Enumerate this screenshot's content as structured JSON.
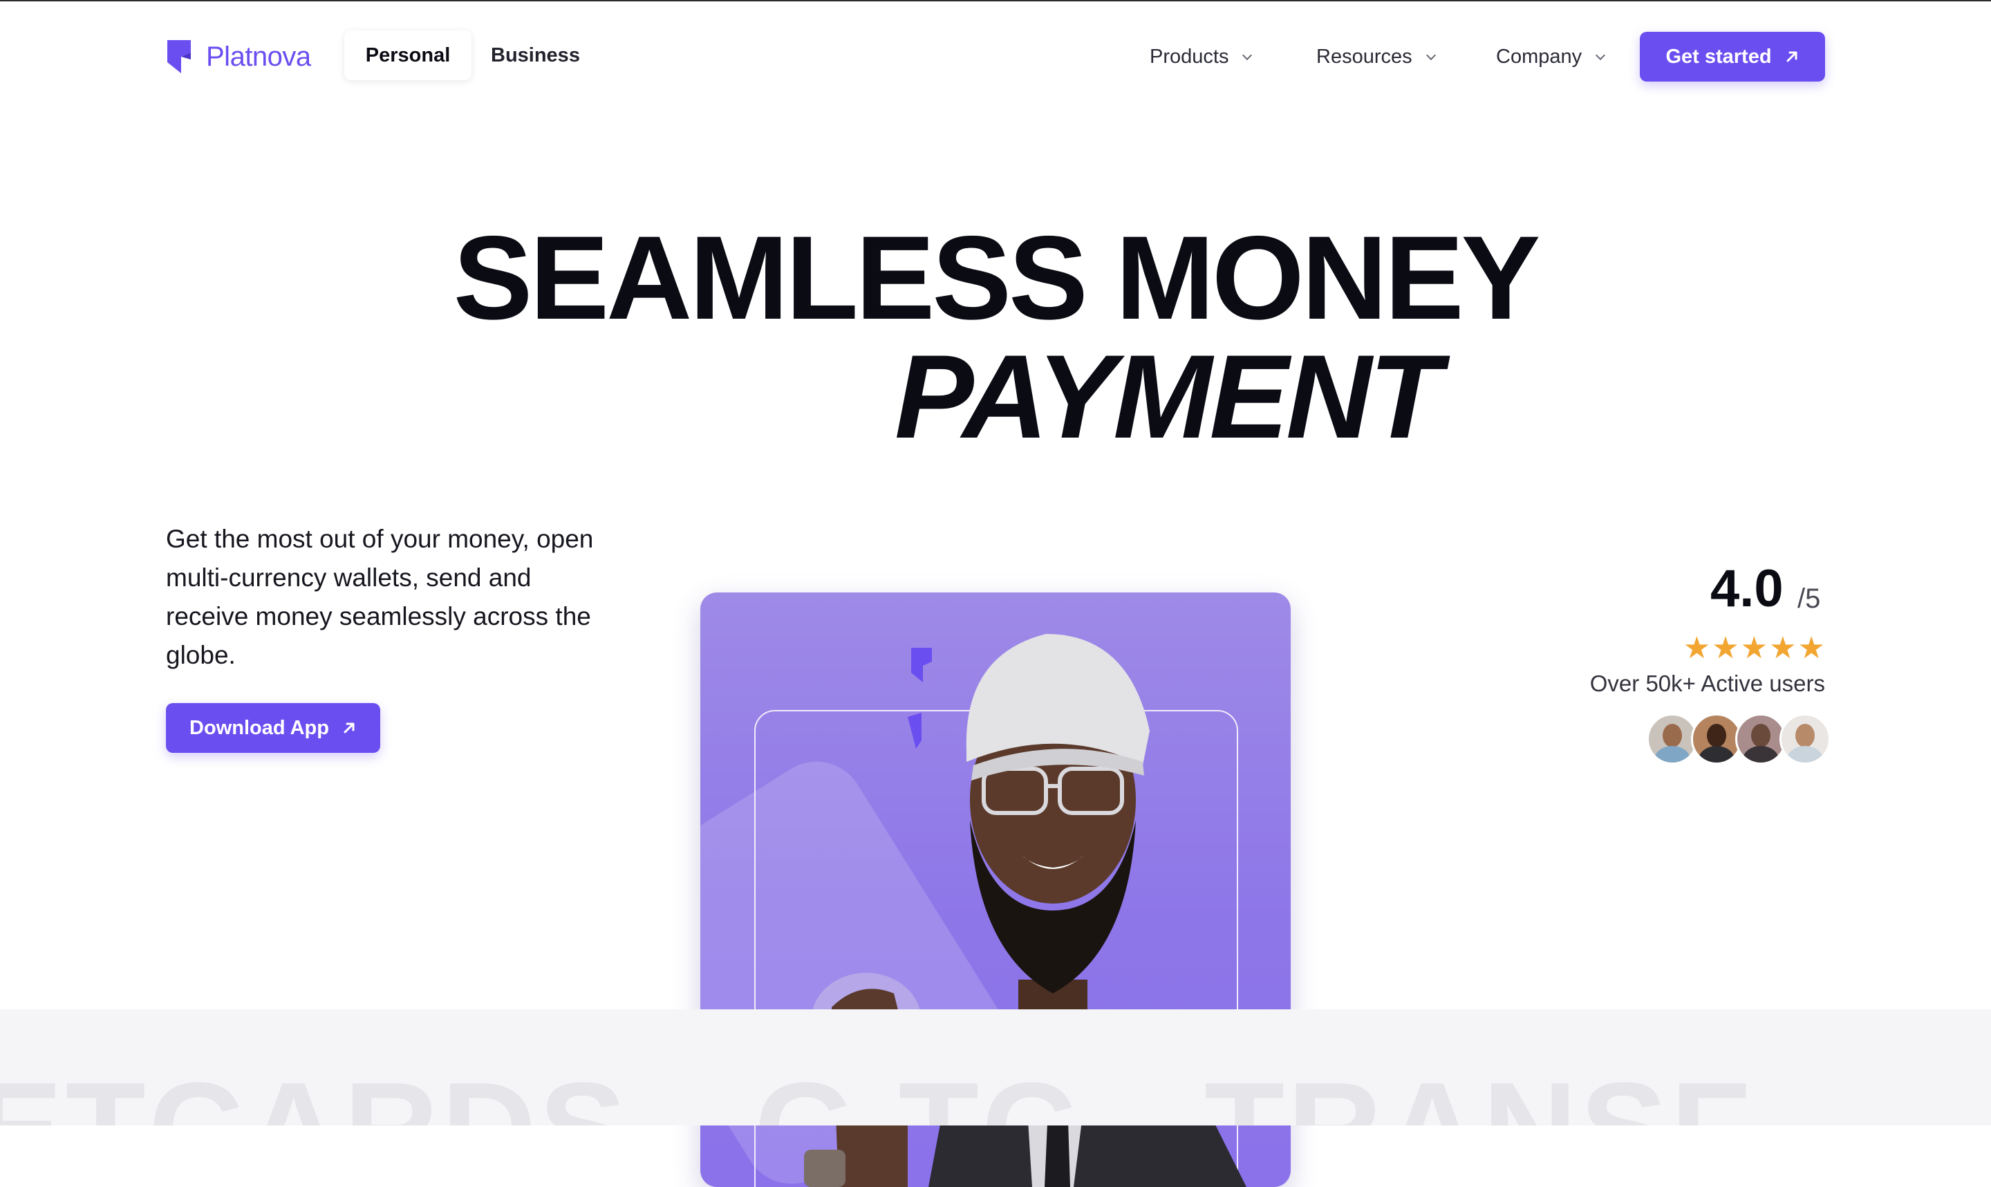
{
  "brand": {
    "name": "Platnova",
    "color": "#6b4ef0"
  },
  "nav": {
    "segments": [
      "Personal",
      "Business"
    ],
    "active_segment": "Personal",
    "menus": [
      "Products",
      "Resources",
      "Company"
    ],
    "cta_label": "Get started"
  },
  "hero": {
    "headline_line1": "SEAMLESS MONEY",
    "headline_line2": "PAYMENT",
    "intro": "Get the most out of your money, open multi-currency wallets, send and receive money seamlessly across the globe.",
    "download_label": "Download App"
  },
  "rating": {
    "score": "4.0",
    "out_of": "/5",
    "stars": 5,
    "users_text": "Over 50k+ Active users",
    "avatar_count": 4
  },
  "marquee": {
    "text": "ETCARDS - G    TC - TRANSF"
  },
  "icons": {
    "logo": "platnova-logo-icon",
    "arrow": "arrow-up-right-icon",
    "chevron": "chevron-down-icon",
    "star": "star-icon"
  }
}
